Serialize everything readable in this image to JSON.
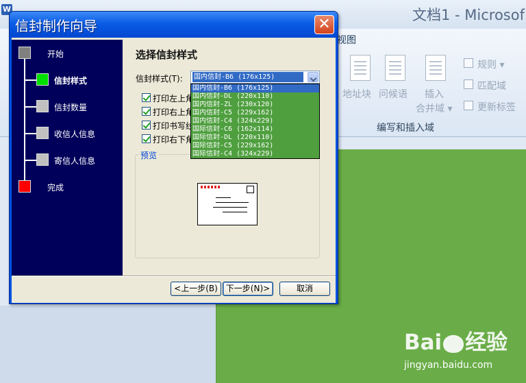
{
  "word_app": {
    "icon_letter": "W",
    "doc_title": "文档1 - Microsof",
    "view_tab": "视图",
    "ribbon": {
      "address_block": "地址块",
      "greeting_line": "问候语",
      "insert_merge_field": [
        "插入",
        "合并域 ▾"
      ],
      "rules": "规则 ▾",
      "match_fields": "匹配域",
      "update_labels": "更新标签",
      "group_label": "编写和插入域"
    },
    "page_color": "#6aad48"
  },
  "watermark": {
    "logo": "Bai  经验",
    "url": "jingyan.baidu.com"
  },
  "dialog": {
    "title": "信封制作向导",
    "close_label": "✕",
    "steps": [
      {
        "label": "开始",
        "color": "#808080"
      },
      {
        "label": "信封样式",
        "color": "#00e000"
      },
      {
        "label": "信封数量",
        "color": "#c0c0c0"
      },
      {
        "label": "收信人信息",
        "color": "#c0c0c0"
      },
      {
        "label": "寄信人信息",
        "color": "#c0c0c0"
      },
      {
        "label": "完成",
        "color": "#ff0000"
      }
    ],
    "active_step": "信封样式",
    "content_title": "选择信封样式",
    "style_label": "信封样式(T):",
    "style_value": "国内信封-B6 (176x125)",
    "style_options": [
      "国内信封-B6 (176x125)",
      "国内信封-DL (220x110)",
      "国内信封-ZL (230x120)",
      "国内信封-C5 (229x162)",
      "国内信封-C4 (324x229)",
      "国际信封-C6 (162x114)",
      "国际信封-DL (220x110)",
      "国际信封-C5 (229x162)",
      "国际信封-C4 (324x229)"
    ],
    "checkboxes": [
      {
        "label": "打印左上角",
        "checked": true
      },
      {
        "label": "打印右上角",
        "checked": true
      },
      {
        "label": "打印书写线",
        "checked": true
      },
      {
        "label": "打印右下角",
        "checked": true
      }
    ],
    "preview_label": "预览",
    "buttons": {
      "back": "<上一步(B)",
      "next": "下一步(N)>",
      "cancel": "取消"
    }
  }
}
